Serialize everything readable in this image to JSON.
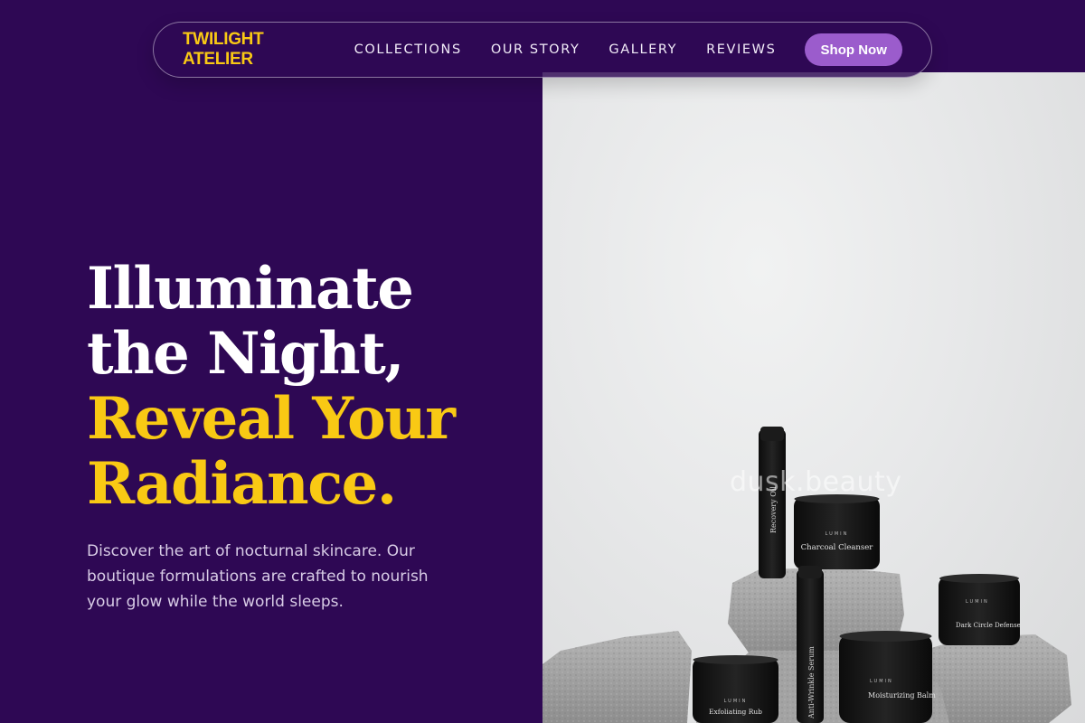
{
  "brand": {
    "name": "TWILIGHT ATELIER"
  },
  "nav": {
    "links": [
      "COLLECTIONS",
      "OUR STORY",
      "GALLERY",
      "REVIEWS"
    ],
    "cta_label": "Shop Now"
  },
  "hero": {
    "headline": {
      "line1": "Illuminate",
      "line2": "the Night,",
      "line3": "Reveal Your",
      "line4": "Radiance."
    },
    "subtext": "Discover the art of nocturnal skincare. Our boutique formulations are crafted to nourish your glow while the world sleeps.",
    "image": {
      "watermark": "dusk.beauty",
      "products": [
        {
          "brand": "LUMIN",
          "name": "Recovery Oil"
        },
        {
          "brand": "LUMIN",
          "name": "Charcoal Cleanser"
        },
        {
          "brand": "LUMIN",
          "name": "Anti-Wrinkle Serum"
        },
        {
          "brand": "LUMIN",
          "name": "Moisturizing Balm"
        },
        {
          "brand": "LUMIN",
          "name": "Dark Circle Defense"
        },
        {
          "brand": "LUMIN",
          "name": "Exfoliating Rub"
        }
      ]
    }
  },
  "colors": {
    "background": "#2e0854",
    "accent_gold": "#f9c914",
    "button_purple": "#9b5ccc"
  }
}
